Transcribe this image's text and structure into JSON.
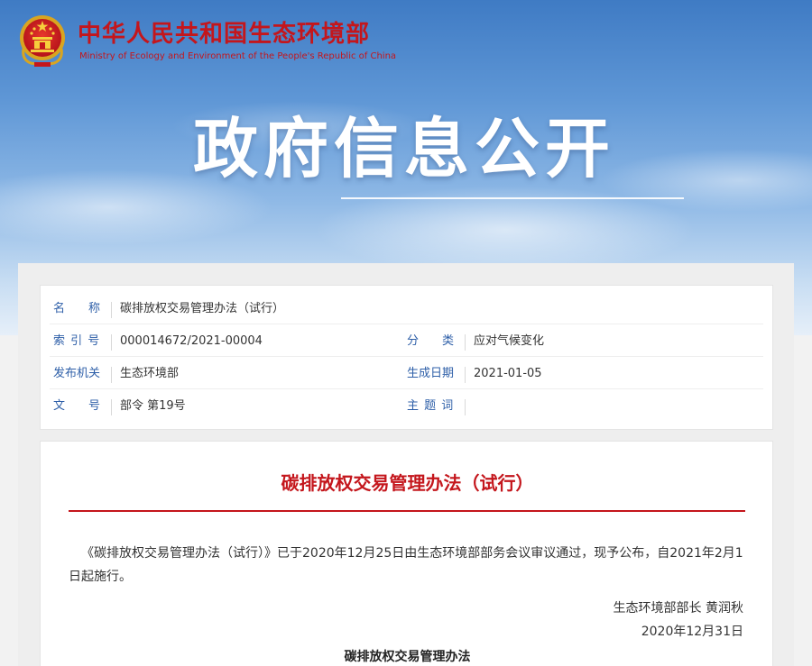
{
  "header": {
    "brand_cn": "中华人民共和国生态环境部",
    "brand_en": "Ministry of Ecology and Environment of the People's Republic of China",
    "hero_title": "政府信息公开",
    "emblem_icon": "national-emblem-icon"
  },
  "meta": {
    "name_label": "名　　称",
    "name_value": "碳排放权交易管理办法（试行）",
    "index_label": "索 引 号",
    "index_value": "000014672/2021-00004",
    "category_label": "分　　类",
    "category_value": "应对气候变化",
    "issuer_label": "发布机关",
    "issuer_value": "生态环境部",
    "date_label": "生成日期",
    "date_value": "2021-01-05",
    "docno_label": "文　　号",
    "docno_value": "部令 第19号",
    "keywords_label": "主 题 词",
    "keywords_value": ""
  },
  "document": {
    "title": "碳排放权交易管理办法（试行）",
    "body": "《碳排放权交易管理办法（试行）》已于2020年12月25日由生态环境部部务会议审议通过，现予公布，自2021年2月1日起施行。",
    "signature": "生态环境部部长 黄润秋",
    "date": "2020年12月31日",
    "subtitle": "碳排放权交易管理办法"
  },
  "colors": {
    "brand_red": "#c4161c",
    "label_blue": "#2e5fa8"
  }
}
